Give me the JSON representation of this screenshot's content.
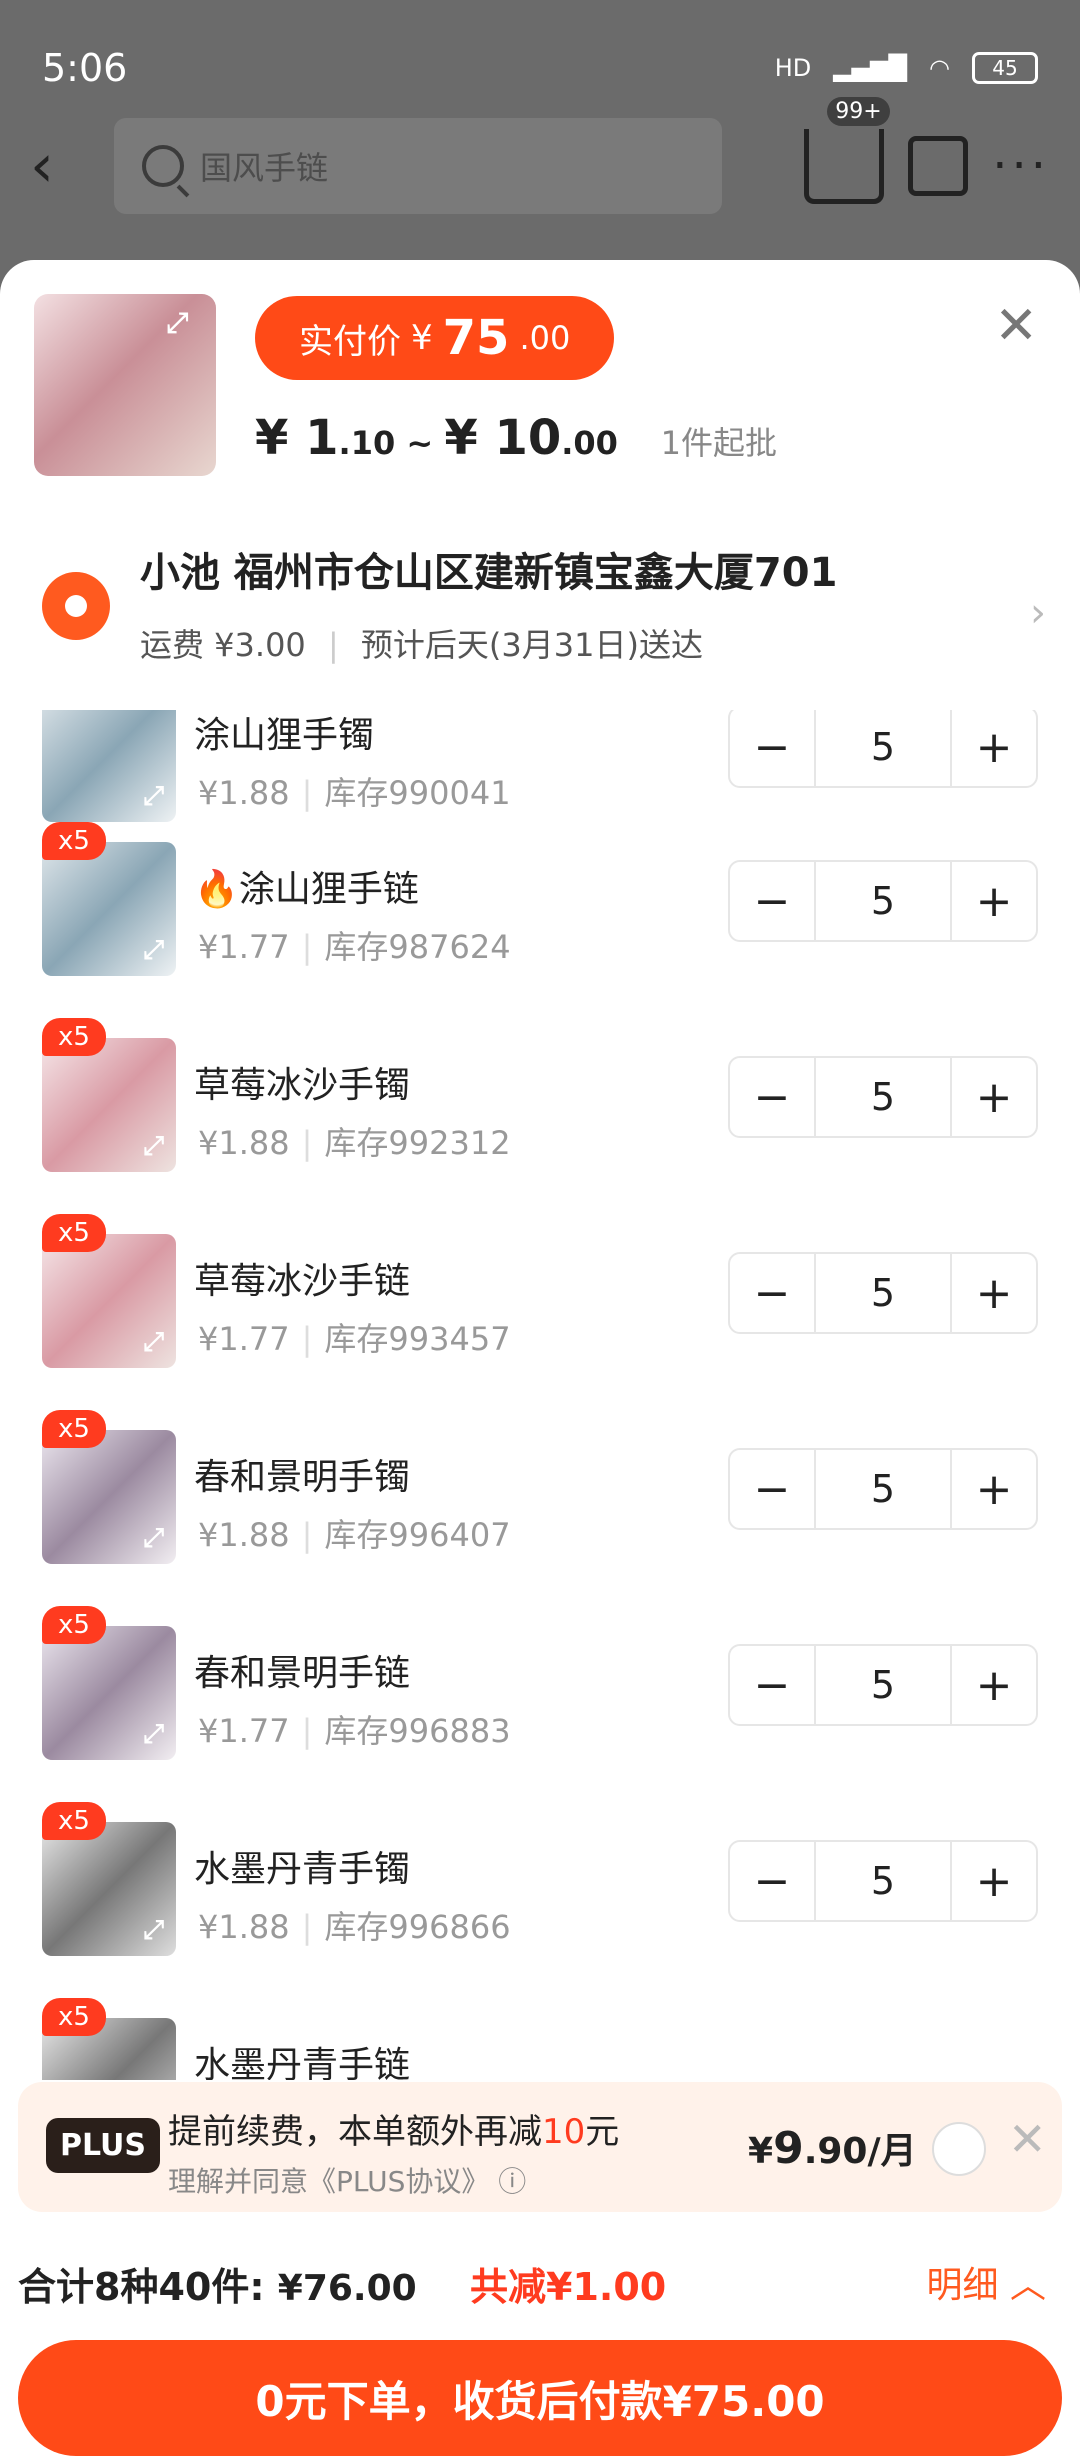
{
  "status": {
    "time": "5:06",
    "battery": "45",
    "network": "HD"
  },
  "topbar": {
    "search_placeholder": "国风手链",
    "cart_badge": "99+"
  },
  "sheet": {
    "price_label": "实付价",
    "price_currency": "¥",
    "price_int": "75",
    "price_dec": ".00",
    "range_low_int": "1",
    "range_low_dec": ".10",
    "range_sep": " ~ ",
    "range_high_int": "10",
    "range_high_dec": ".00",
    "moq": "1件起批",
    "currency": "¥"
  },
  "address": {
    "line1": "小池 福州市仓山区建新镇宝鑫大厦701",
    "shipping": "运费 ¥3.00",
    "eta": "预计后天(3月31日)送达"
  },
  "items": [
    {
      "badge": "",
      "name": "涂山狸手镯",
      "price": "¥1.88",
      "stock": "库存990041",
      "qty": "5"
    },
    {
      "badge": "x5",
      "name": "涂山狸手链",
      "price": "¥1.77",
      "stock": "库存987624",
      "qty": "5"
    },
    {
      "badge": "x5",
      "name": "草莓冰沙手镯",
      "price": "¥1.88",
      "stock": "库存992312",
      "qty": "5"
    },
    {
      "badge": "x5",
      "name": "草莓冰沙手链",
      "price": "¥1.77",
      "stock": "库存993457",
      "qty": "5"
    },
    {
      "badge": "x5",
      "name": "春和景明手镯",
      "price": "¥1.88",
      "stock": "库存996407",
      "qty": "5"
    },
    {
      "badge": "x5",
      "name": "春和景明手链",
      "price": "¥1.77",
      "stock": "库存996883",
      "qty": "5"
    },
    {
      "badge": "x5",
      "name": "水墨丹青手镯",
      "price": "¥1.88",
      "stock": "库存996866",
      "qty": "5"
    },
    {
      "badge": "x5",
      "name": "水墨丹青手链",
      "price": "",
      "stock": "",
      "qty": "5"
    }
  ],
  "plus": {
    "logo": "PLUS",
    "text_pre": "提前续费，本单额外再减",
    "text_amount": "10",
    "text_post": "元",
    "agree": "理解并同意《PLUS协议》",
    "price_currency": "¥",
    "price_int": "9",
    "price_dec": ".90/月"
  },
  "summary": {
    "label": "合计8种40件:",
    "amount": "¥76.00",
    "discount": "共减¥1.00",
    "detail": "明细"
  },
  "cta": {
    "label": "0元下单，收货后付款¥75.00"
  },
  "colors": {
    "accent": "#ff4a17",
    "red": "#ff3b1f"
  }
}
